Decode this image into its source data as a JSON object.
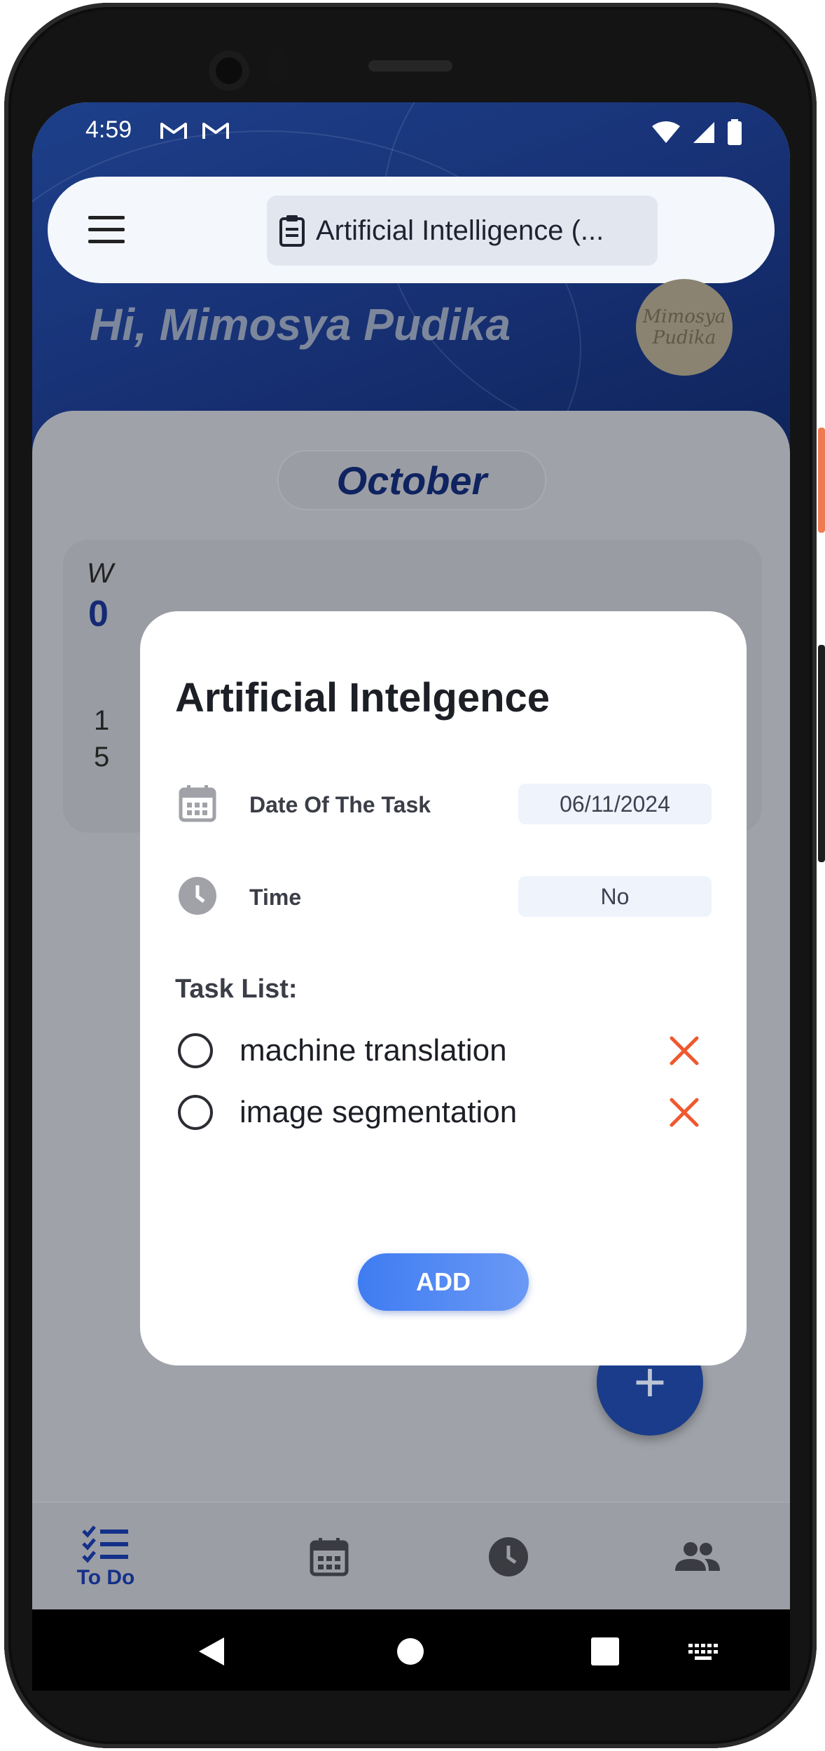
{
  "status_bar": {
    "time": "4:59"
  },
  "app_bar": {
    "title": "Artificial Intelligence (..."
  },
  "greeting": "Hi, Mimosya Pudika",
  "avatar": {
    "line1": "Mimosya",
    "line2": "Pudika"
  },
  "month": "October",
  "week_card": {
    "w": "W",
    "num": "0",
    "line1": "1",
    "line2": "5"
  },
  "dialog": {
    "title": "Artificial Intelgence",
    "date_label": "Date Of The Task",
    "date_value": "06/11/2024",
    "time_label": "Time",
    "time_value": "No",
    "task_list_label": "Task List:",
    "tasks": [
      {
        "name": "machine translation"
      },
      {
        "name": "image segmentation"
      }
    ],
    "add_label": "ADD"
  },
  "bottom_nav": {
    "todo_label": "To Do",
    "items": [
      "todo-icon",
      "calendar-icon",
      "clock-icon",
      "people-icon"
    ]
  },
  "colors": {
    "primary_dark": "#183276",
    "accent_blue": "#3f7cf2",
    "delete_orange": "#f0582e",
    "nav_active": "#15308a"
  }
}
